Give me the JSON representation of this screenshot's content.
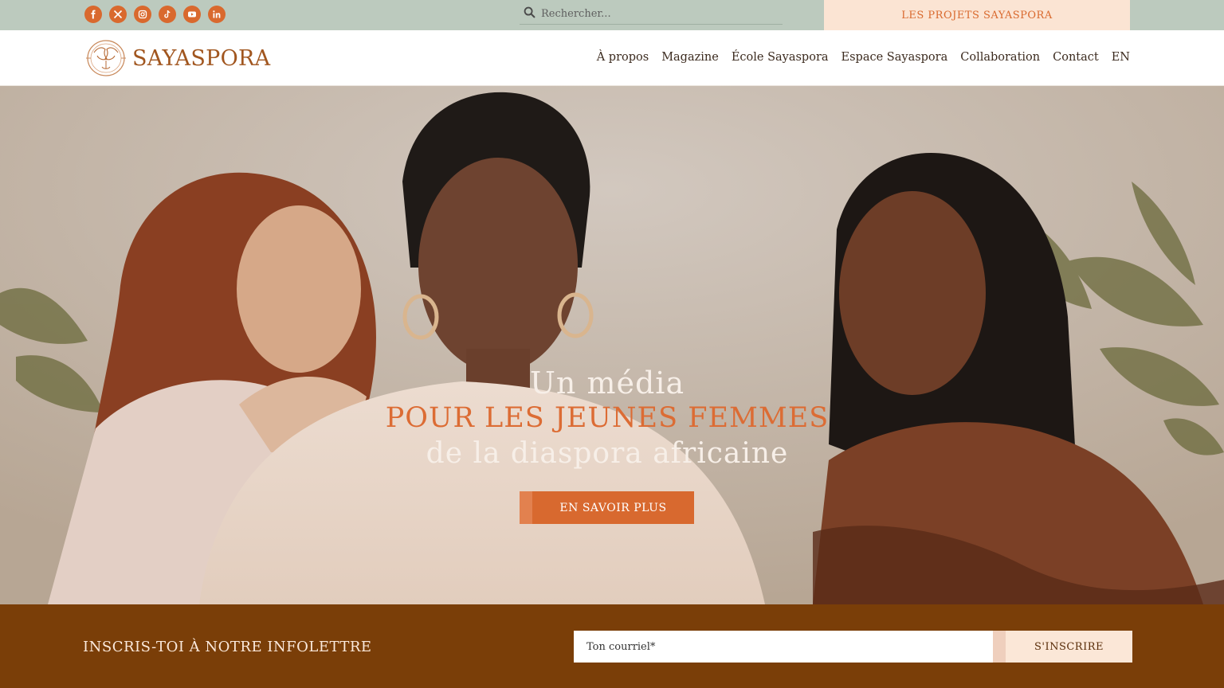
{
  "topbar": {
    "socials": [
      {
        "name": "facebook-icon",
        "glyph": "f"
      },
      {
        "name": "x-twitter-icon",
        "glyph": "𝕏"
      },
      {
        "name": "instagram-icon",
        "glyph": ""
      },
      {
        "name": "tiktok-icon",
        "glyph": ""
      },
      {
        "name": "youtube-icon",
        "glyph": ""
      },
      {
        "name": "linkedin-icon",
        "glyph": "in"
      }
    ],
    "search_placeholder": "Rechercher...",
    "projects_label": "LES PROJETS SAYASPORA"
  },
  "header": {
    "logo_text": "SAYASPORA",
    "nav": [
      "À propos",
      "Magazine",
      "École Sayaspora",
      "Espace Sayaspora",
      "Collaboration",
      "Contact",
      "EN"
    ]
  },
  "hero": {
    "line1": "Un média",
    "line2": "POUR LES JEUNES FEMMES",
    "line3": "de la diaspora africaine",
    "cta_label": "EN SAVOIR PLUS"
  },
  "newsletter": {
    "title": "INSCRIS-TOI À NOTRE INFOLETTRE",
    "input_placeholder": "Ton courriel*",
    "button_label": "S'INSCRIRE"
  },
  "colors": {
    "accent": "#d9692e",
    "topbar_bg": "#bccabe",
    "projects_bg": "#fbe4d3",
    "newsletter_bg": "#7a3e08",
    "logo": "#a1561f"
  }
}
